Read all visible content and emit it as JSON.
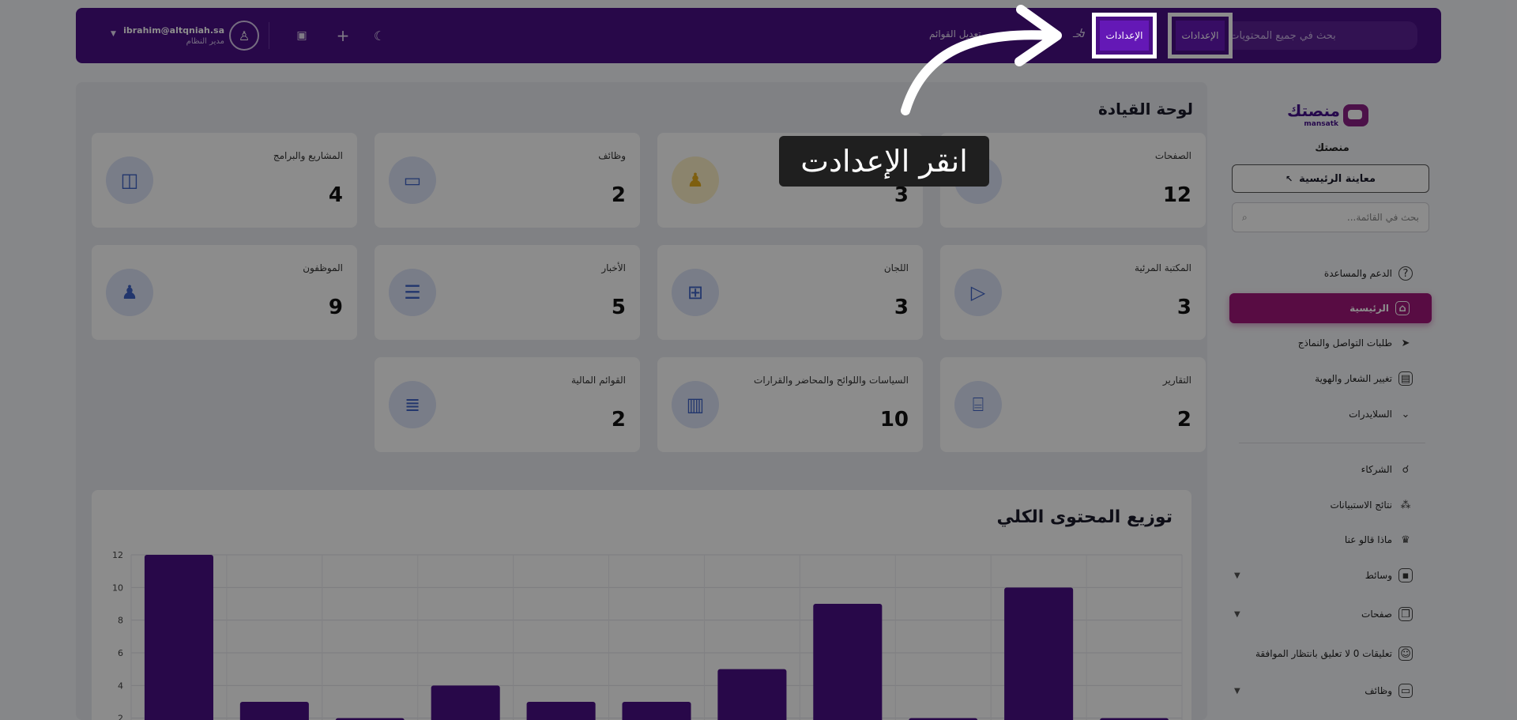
{
  "topbar": {
    "search_placeholder": "بحث في جميع المحتويات...",
    "settings_label": "الإعدادات",
    "quick_label": "تحـ",
    "edit_lists_label": "تعديل القوائم",
    "user_email": "ibrahim@altqniah.sa",
    "user_role": "مدير النظام"
  },
  "sidebar": {
    "logo_ar": "منصتك",
    "logo_en": "mansatk",
    "brand_name": "منصتك",
    "preview_label": "معاينة الرئيسية",
    "search_placeholder": "بحث في القائمة...",
    "items": [
      {
        "label": "الدعم والمساعدة",
        "icon": "help-icon"
      },
      {
        "label": "الرئيسية",
        "icon": "home-icon",
        "active": true
      },
      {
        "label": "طلبات التواصل والنماذج",
        "icon": "send-icon"
      },
      {
        "label": "تغيير الشعار والهوية",
        "icon": "layout-icon"
      },
      {
        "label": "السلايدرات",
        "icon": "chevron-down-icon"
      },
      {
        "label": "الشركاء",
        "icon": "handshake-icon"
      },
      {
        "label": "نتائج الاستبيانات",
        "icon": "grid-icon"
      },
      {
        "label": "ماذا قالو عنا",
        "icon": "crown-icon"
      },
      {
        "label": "وسائط",
        "icon": "image-icon",
        "expandable": true
      },
      {
        "label": "صفحات",
        "icon": "page-icon",
        "expandable": true
      },
      {
        "label": "تعليقات 0 لا تعليق بانتظار الموافقة",
        "icon": "comment-icon"
      },
      {
        "label": "وظائف",
        "icon": "briefcase-icon",
        "expandable": true
      }
    ]
  },
  "main": {
    "title": "لوحة القيادة",
    "cards": [
      {
        "label": "الصفحات",
        "value": "12",
        "icon": "page-icon"
      },
      {
        "label": "",
        "value": "3",
        "icon": "users-icon"
      },
      {
        "label": "وظائف",
        "value": "2",
        "icon": "briefcase-icon"
      },
      {
        "label": "المشاريع والبرامج",
        "value": "4",
        "icon": "bag-icon"
      },
      {
        "label": "المكتبة المرئية",
        "value": "3",
        "icon": "video-icon"
      },
      {
        "label": "اللجان",
        "value": "3",
        "icon": "apps-icon"
      },
      {
        "label": "الأخبار",
        "value": "5",
        "icon": "news-icon"
      },
      {
        "label": "الموظفون",
        "value": "9",
        "icon": "users-icon"
      },
      {
        "label": "التقارير",
        "value": "2",
        "icon": "report-icon"
      },
      {
        "label": "السياسات واللوائح والمحاضر والقرارات",
        "value": "10",
        "icon": "book-icon"
      },
      {
        "label": "القوائم المالية",
        "value": "2",
        "icon": "list-icon"
      }
    ]
  },
  "tooltip": {
    "text": "انقر الإعدادت"
  },
  "chart_data": {
    "type": "bar",
    "title": "توزيع المحتوى الكلي",
    "values": [
      12,
      3,
      2,
      4,
      3,
      3,
      5,
      9,
      2,
      10,
      2
    ],
    "ylim": [
      0,
      12
    ],
    "yticks": [
      2,
      4,
      6,
      8,
      10,
      12
    ],
    "grid": true,
    "color": "#4a0f86"
  },
  "colors": {
    "topbar": "#4a0f86",
    "active_item": "#a0167a",
    "icon_blue": "#3e63c6"
  }
}
